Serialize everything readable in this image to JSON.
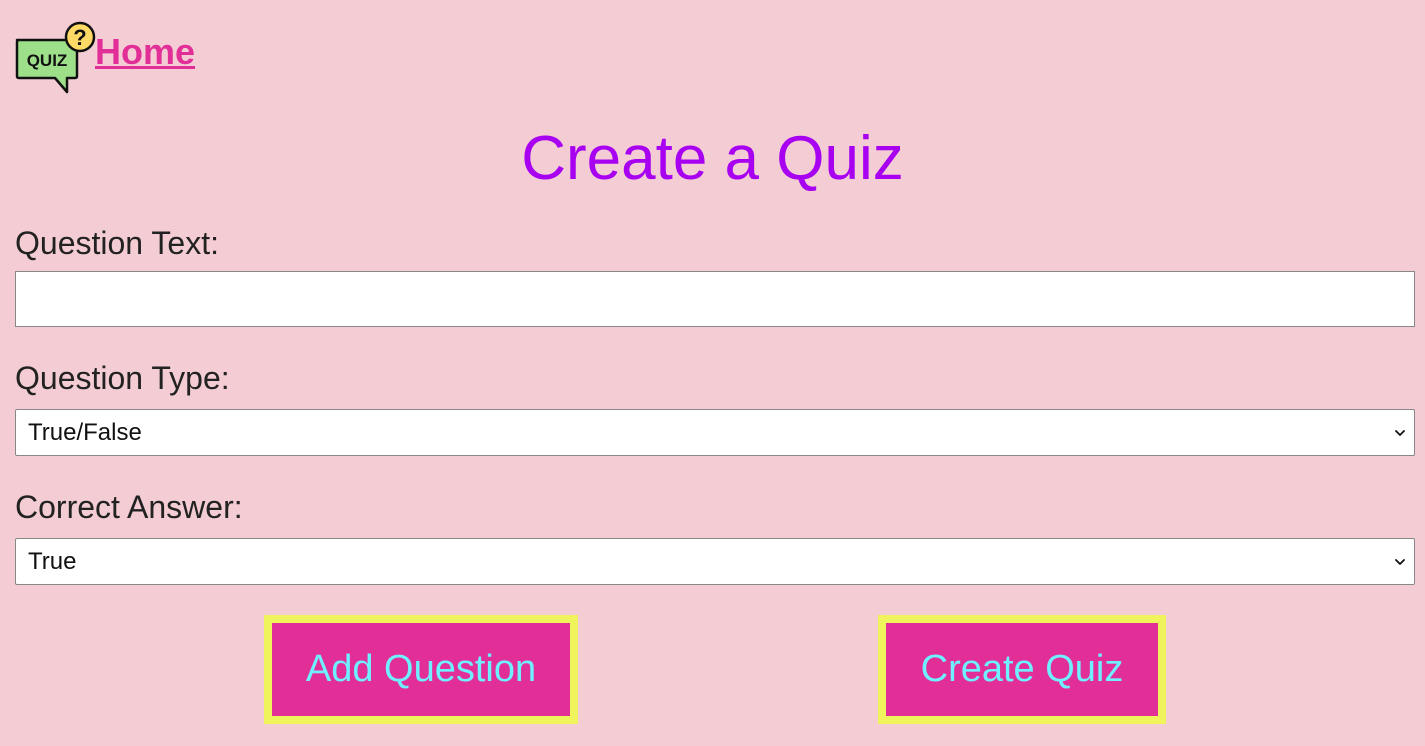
{
  "nav": {
    "logo_text": "QUIZ",
    "logo_badge": "?",
    "home_label": "Home"
  },
  "page": {
    "title": "Create a Quiz"
  },
  "form": {
    "question_text_label": "Question Text:",
    "question_text_value": "",
    "question_text_placeholder": "",
    "question_type_label": "Question Type:",
    "question_type_selected": "True/False",
    "correct_answer_label": "Correct Answer:",
    "correct_answer_selected": "True"
  },
  "actions": {
    "add_question_label": "Add Question",
    "create_quiz_label": "Create Quiz"
  },
  "colors": {
    "background": "#f4cdd4",
    "title": "#a800f0",
    "link": "#e22f98",
    "button_bg": "#e22f98",
    "button_border": "#f0f45c",
    "button_text": "#6ff0ff",
    "logo_bubble": "#9ee08a",
    "logo_badge": "#ffd966"
  },
  "icons": {
    "logo": "quiz-speech-bubble-icon",
    "select_arrow": "chevron-down-icon"
  }
}
